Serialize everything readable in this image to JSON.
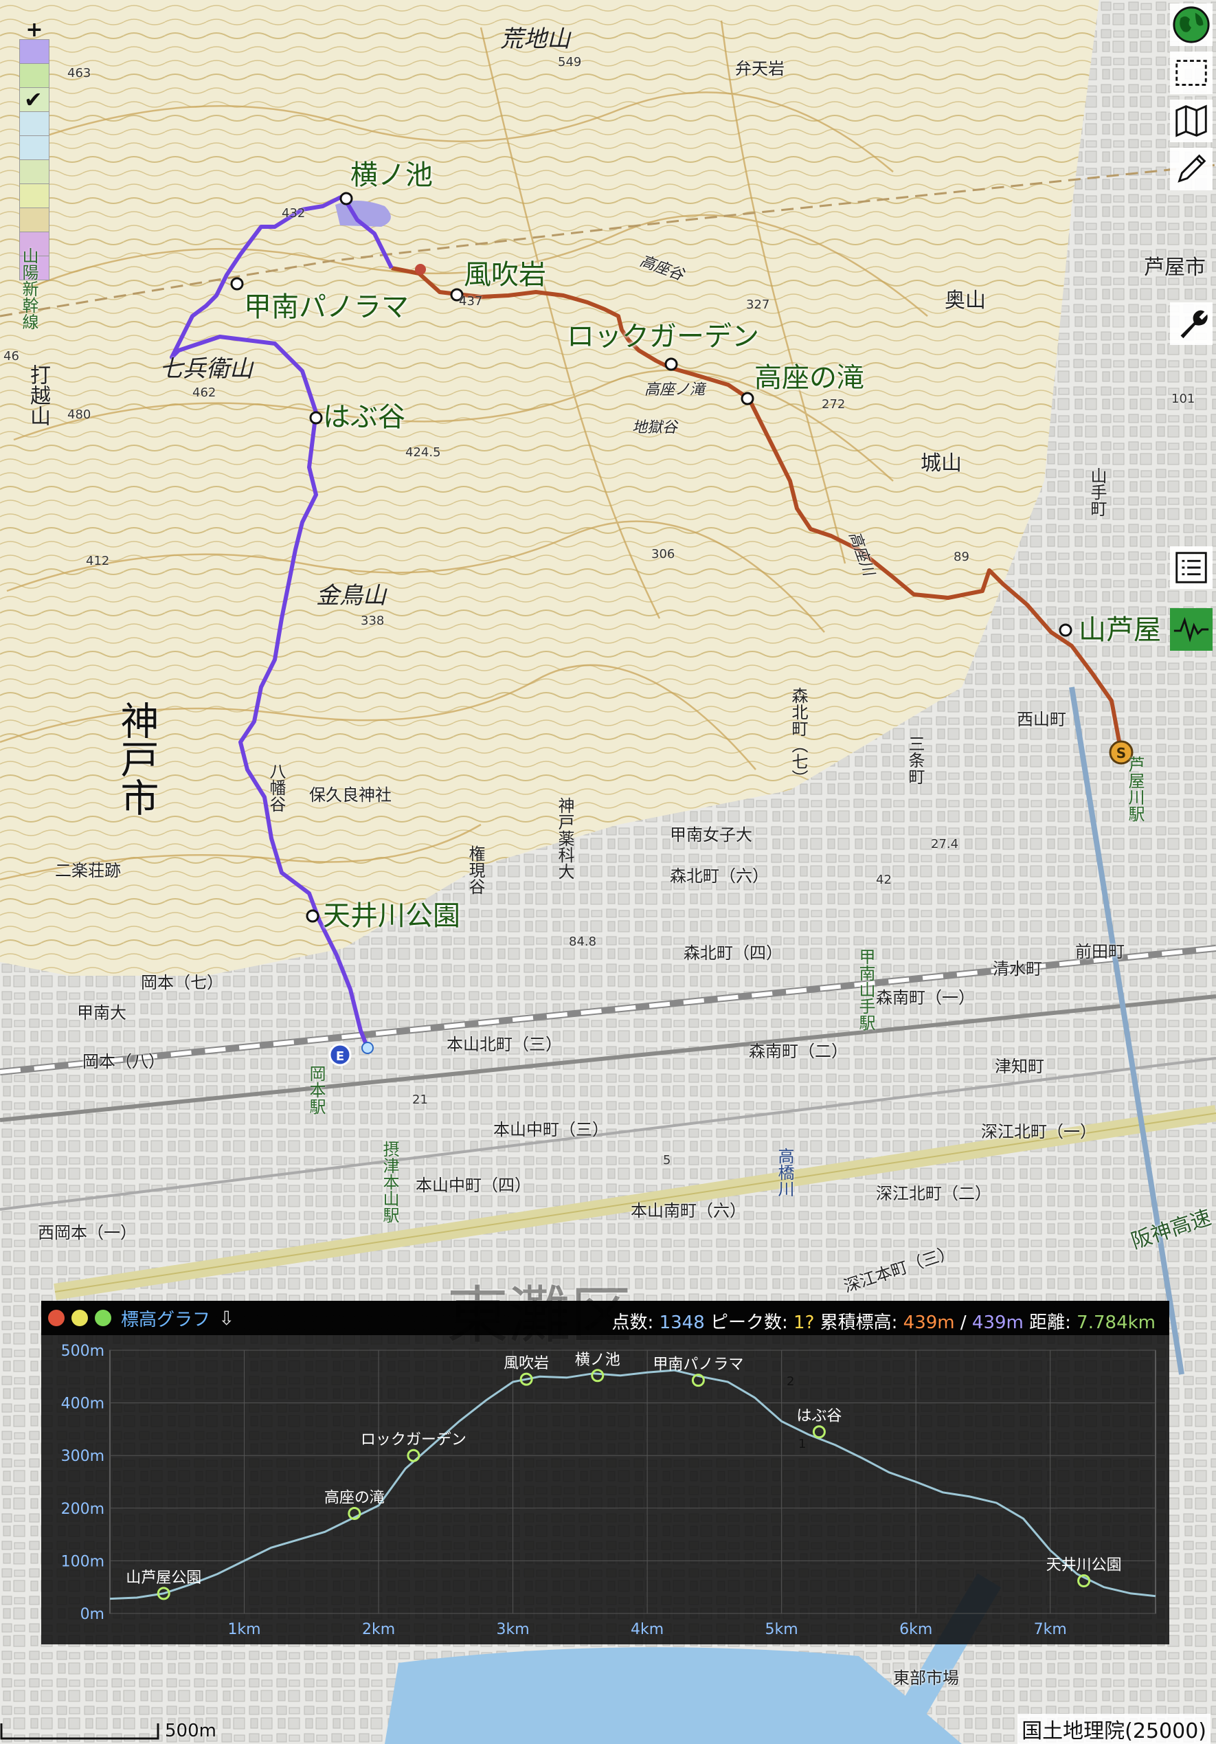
{
  "toolbar": {
    "right_top": [
      "globe-icon",
      "select-rect-icon",
      "map-icon",
      "pencil-icon",
      "wrench-icon"
    ],
    "right_mid": [
      "list-icon",
      "elevation-icon"
    ]
  },
  "layers": {
    "plus": "+"
  },
  "waypoints": {
    "yokonoike": "横ノ池",
    "fukiiwa": "風吹岩",
    "konan_panorama": "甲南パノラマ",
    "rock_garden": "ロックガーデン",
    "takaza_falls": "高座の滝",
    "habudani": "はぶ谷",
    "ashiya": "山芦屋",
    "amaigawa": "天井川公園"
  },
  "places": {
    "arachiyama": "荒地山",
    "bentenwa": "弁天岩",
    "shichibee": "七兵衛山",
    "kintoriyama": "金鳥山",
    "okuyama": "奥山",
    "shiroyama": "城山",
    "kobe": "神戸市",
    "hokurajinja": "保久良神社",
    "niraku": "二楽荘跡",
    "okamoto7": "岡本（七）",
    "konandai": "甲南大",
    "okamoto8": "岡本（八）",
    "motoyama_kita3": "本山北町（三）",
    "motoyama_naka3": "本山中町（三）",
    "motoyama_naka4": "本山中町（四）",
    "motoyama_minami6": "本山南町（六）",
    "morikita6": "森北町（六）",
    "morikita4": "森北町（四）",
    "morominami1": "森南町（一）",
    "morominami2": "森南町（二）",
    "konan_joshi": "甲南女子大",
    "nishiyama": "西山町",
    "shimizu": "清水町",
    "maeda": "前田町",
    "tsuchi": "津知町",
    "fukae_kita1": "深江北町（一）",
    "fukae_kita2": "深江北町（二）",
    "fukae_hon": "深江本町（三）",
    "nishiokamoto": "西岡本（一）",
    "hanshin": "阪神高速",
    "ashiya_city": "芦屋市",
    "tokaido_shinkansen": "山陽新幹線",
    "ashiyagawa_st": "芦屋川駅",
    "okamoto_st": "岡本駅",
    "settsu": "摂津本山駅",
    "higashinada": "東灘区",
    "tobu": "東部市場",
    "takahashi": "高橋川",
    "takazadani": "高座谷",
    "jigokudani": "地獄谷",
    "takazanotaki_small": "高座ノ滝",
    "takazagawa": "高座川",
    "yamate": "山手町",
    "gongendani": "権現谷",
    "hachiwa": "八幡谷",
    "konan_yamate": "甲南山手駅",
    "kobe_yakka": "神戸薬科大",
    "koshikiyama": "打越山",
    "sanjo": "三条町",
    "morikita7": "森北町（七）"
  },
  "elevations": [
    "463",
    "549",
    "432",
    "437",
    "327",
    "272",
    "462",
    "480",
    "424.5",
    "412",
    "306",
    "338",
    "89",
    "101",
    "84.8",
    "27.4",
    "42",
    "21",
    "5",
    "2",
    "1",
    "46"
  ],
  "scale": {
    "label": "500m"
  },
  "credit": "国土地理院(25000)",
  "graph": {
    "title": "標高グラフ",
    "dot_colors": [
      "#e0543c",
      "#e8e25a",
      "#7ed957"
    ],
    "stats": {
      "points_label": "点数:",
      "points": "1348",
      "peaks_label": "ピーク数:",
      "peaks": "1?",
      "gain_label": "累積標高:",
      "gain_up": "439m",
      "slash": "/",
      "gain_down": "439m",
      "distance_label": "距離:",
      "distance": "7.784km"
    }
  },
  "chart_data": {
    "type": "line",
    "title": "標高グラフ",
    "xlabel": "",
    "ylabel": "",
    "xlim": [
      0,
      7.784
    ],
    "ylim": [
      0,
      500
    ],
    "x_ticks": [
      "1km",
      "2km",
      "3km",
      "4km",
      "5km",
      "6km",
      "7km"
    ],
    "x_tick_values": [
      1,
      2,
      3,
      4,
      5,
      6,
      7
    ],
    "y_ticks": [
      "0m",
      "100m",
      "200m",
      "300m",
      "400m",
      "500m"
    ],
    "y_tick_values": [
      0,
      100,
      200,
      300,
      400,
      500
    ],
    "grid": true,
    "line_color": "#9dc7d6",
    "series": [
      {
        "x": [
          0,
          0.2,
          0.4,
          0.6,
          0.8,
          1.0,
          1.2,
          1.4,
          1.6,
          1.8,
          2.0,
          2.2,
          2.4,
          2.6,
          2.8,
          3.0,
          3.2,
          3.4,
          3.6,
          3.8,
          4.0,
          4.2,
          4.4,
          4.6,
          4.8,
          5.0,
          5.2,
          5.4,
          5.6,
          5.8,
          6.0,
          6.2,
          6.4,
          6.6,
          6.8,
          7.0,
          7.2,
          7.4,
          7.6,
          7.784
        ],
        "y": [
          28,
          30,
          38,
          55,
          75,
          100,
          125,
          140,
          155,
          180,
          205,
          275,
          320,
          365,
          405,
          440,
          450,
          448,
          456,
          452,
          458,
          462,
          450,
          440,
          410,
          365,
          340,
          320,
          295,
          268,
          250,
          230,
          222,
          210,
          180,
          120,
          75,
          50,
          38,
          33
        ]
      }
    ],
    "markers": [
      {
        "label": "山芦屋公園",
        "x": 0.4,
        "y": 38
      },
      {
        "label": "高座の滝",
        "x": 1.82,
        "y": 190
      },
      {
        "label": "ロックガーデン",
        "x": 2.26,
        "y": 300
      },
      {
        "label": "風吹岩",
        "x": 3.1,
        "y": 445
      },
      {
        "label": "横ノ池",
        "x": 3.63,
        "y": 452
      },
      {
        "label": "甲南パノラマ",
        "x": 4.38,
        "y": 443
      },
      {
        "label": "はぶ谷",
        "x": 5.28,
        "y": 345
      },
      {
        "label": "天井川公園",
        "x": 7.25,
        "y": 62
      }
    ]
  }
}
